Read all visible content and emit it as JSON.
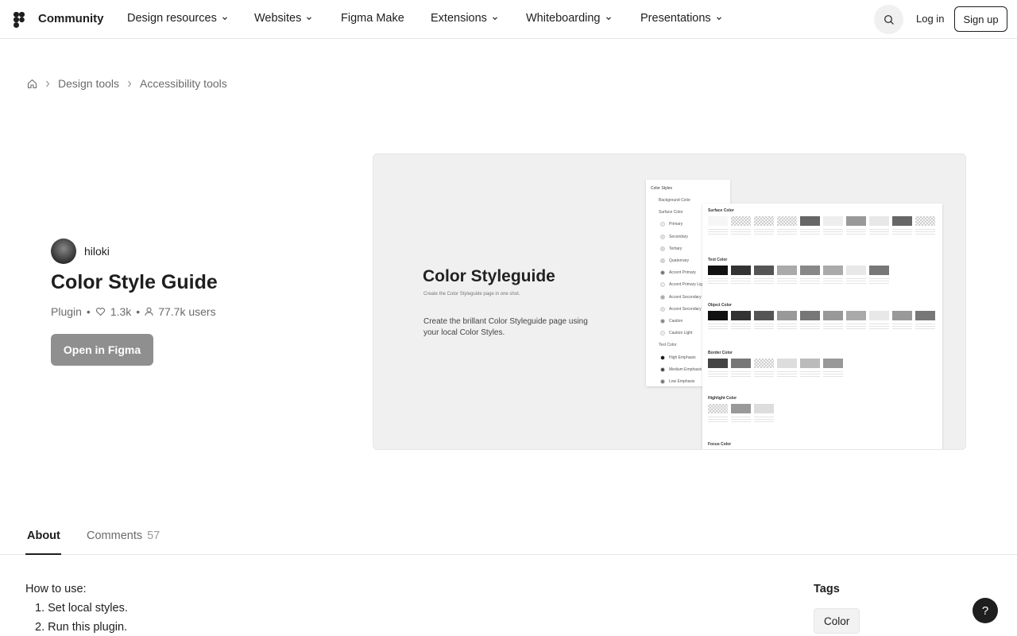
{
  "nav": {
    "brand": "Community",
    "items": [
      {
        "label": "Design resources",
        "has_menu": true
      },
      {
        "label": "Websites",
        "has_menu": true
      },
      {
        "label": "Figma Make",
        "has_menu": false
      },
      {
        "label": "Extensions",
        "has_menu": true
      },
      {
        "label": "Whiteboarding",
        "has_menu": true
      },
      {
        "label": "Presentations",
        "has_menu": true
      }
    ],
    "login": "Log in",
    "signup": "Sign up",
    "icons": {
      "logo": "figma-logo-icon",
      "search": "search-icon",
      "chevron": "chevron-down-icon"
    }
  },
  "breadcrumb": {
    "home_icon": "home-icon",
    "items": [
      "Design tools",
      "Accessibility tools"
    ]
  },
  "resource": {
    "author": "hiloki",
    "title": "Color Style Guide",
    "type": "Plugin",
    "likes": "1.3k",
    "users": "77.7k users",
    "open_button": "Open in Figma",
    "button_color": "#8f8f8f"
  },
  "preview": {
    "title": "Color Styleguide",
    "subtitle": "Create the Color Styleguide page in one shot.",
    "description": "Create the brillant Color Styleguide page using your local Color Styles.",
    "panel_header": "Color Styles",
    "panel_rows": [
      "Background Color",
      "Surface Color",
      "Primary",
      "Secondary",
      "Tertiary",
      "Quaternary",
      "Accent Primary",
      "Accent Primary Lig",
      "Accent Secondary",
      "Accent Secondary",
      "Caution",
      "Caution Light",
      "Text Color",
      "High Emphasis",
      "Medium Emphasis",
      "Low Emphasis"
    ],
    "sections": [
      "Surface Color",
      "Text Color",
      "Object Color",
      "Border Color",
      "Highlight Color",
      "Focus Color"
    ]
  },
  "tabs": {
    "about": "About",
    "comments": "Comments",
    "comments_count": "57"
  },
  "about": {
    "heading": "How to use:",
    "steps": [
      "1. Set local styles.",
      "2. Run this plugin."
    ]
  },
  "tags": {
    "heading": "Tags",
    "items": [
      "Color"
    ]
  },
  "help": "?"
}
